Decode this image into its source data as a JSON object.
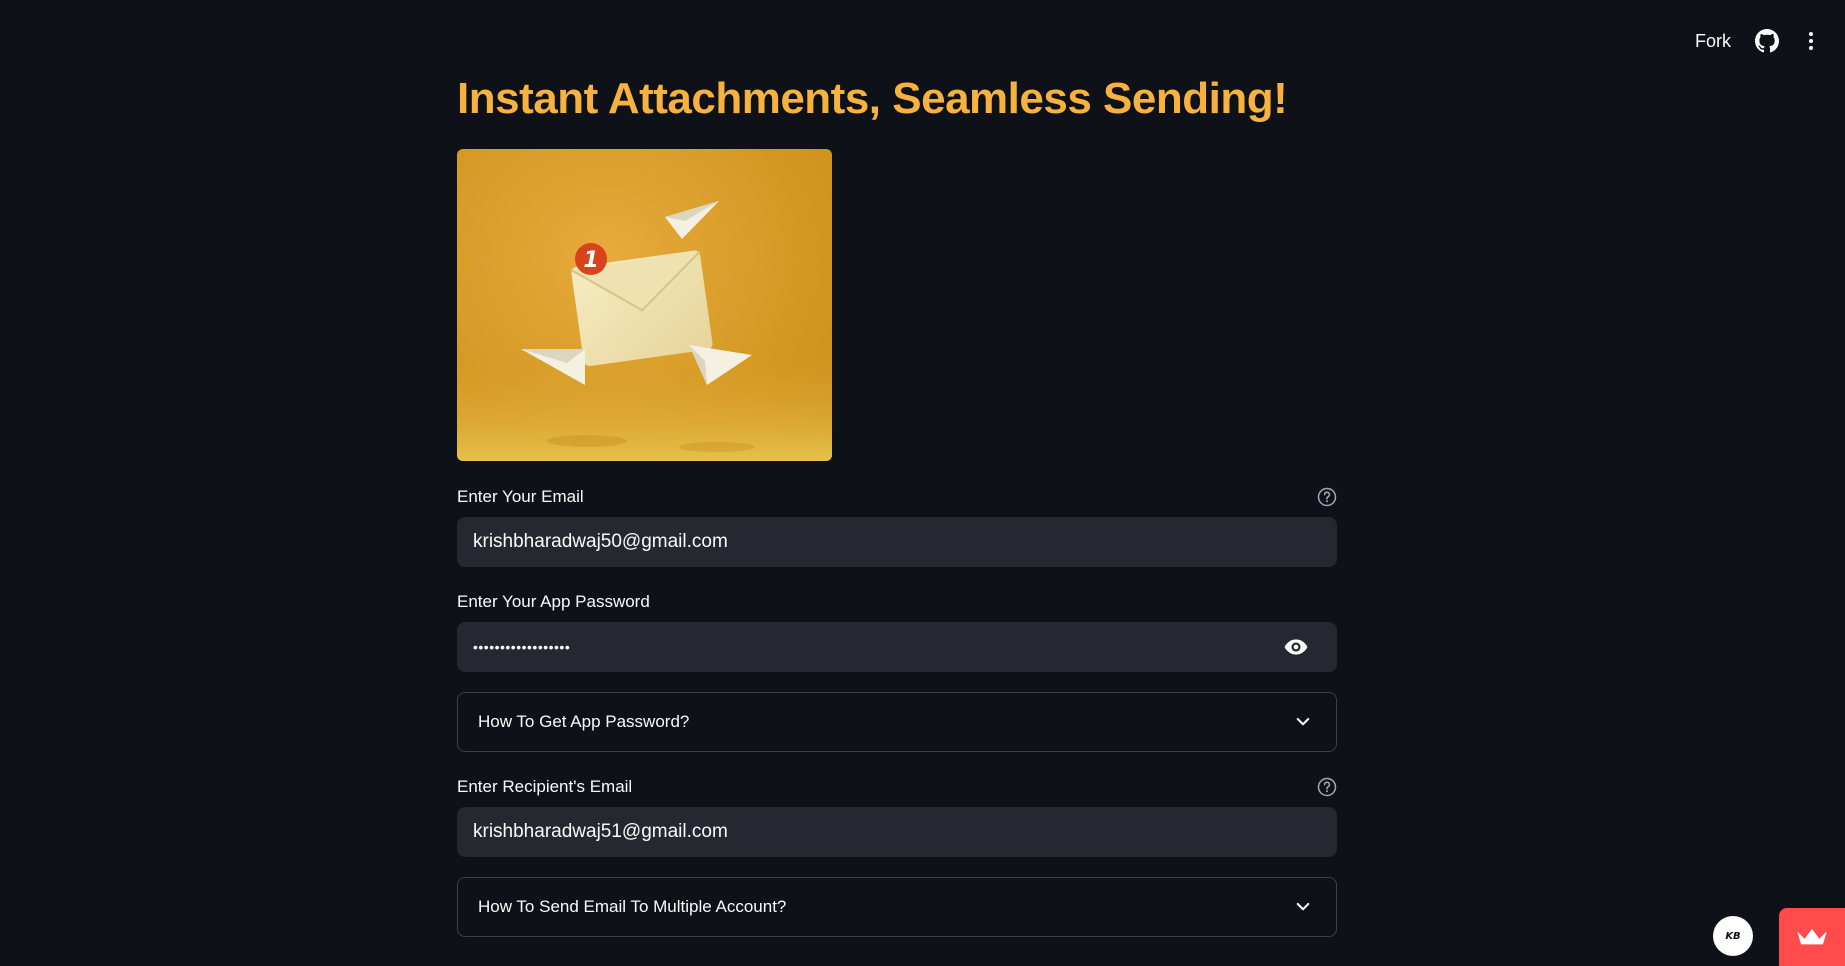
{
  "topbar": {
    "fork_label": "Fork",
    "github_icon": "github-icon",
    "menu_icon": "kebab-menu-icon"
  },
  "page": {
    "title": "Instant Attachments, Seamless Sending!",
    "title_color": "#f7b13e",
    "hero_image": "envelope-with-paper-planes-illustration"
  },
  "form": {
    "email_label": "Enter Your Email",
    "email_value": "krishbharadwaj50@gmail.com",
    "password_label": "Enter Your App Password",
    "password_value": "••••••••••••••••••",
    "app_password_expander": "How To Get App Password?",
    "recipient_label": "Enter Recipient's Email",
    "recipient_value": "krishbharadwaj51@gmail.com",
    "multiple_expander": "How To Send Email To Multiple Account?"
  },
  "footer": {
    "avatar_text": "KB",
    "badge_icon": "crown-icon",
    "badge_color": "#ff4b4b"
  }
}
